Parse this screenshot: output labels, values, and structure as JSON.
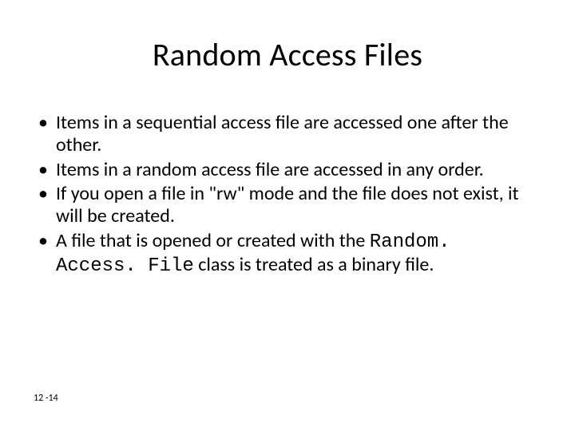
{
  "slide": {
    "title": "Random Access Files",
    "bullets": [
      {
        "text": "Items in a sequential access file are accessed one after the other."
      },
      {
        "text": "Items in a random access file are accessed in any order."
      },
      {
        "text": "If you open a file in \"rw\" mode and the file does not exist, it will be created."
      },
      {
        "prefix": "A file that is opened or created with the ",
        "code": "Random. Access. File",
        "suffix": " class is treated as a binary file."
      }
    ],
    "footer": "12 -14"
  }
}
